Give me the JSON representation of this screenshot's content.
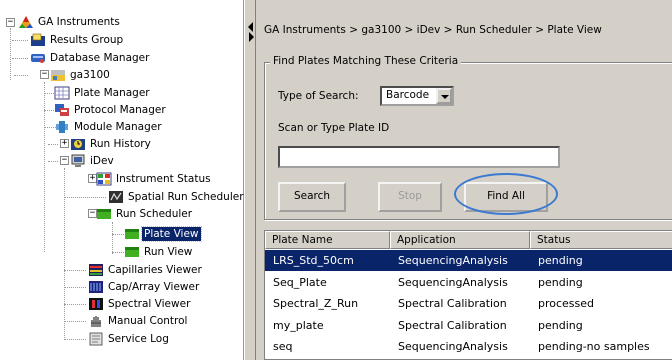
{
  "tree": {
    "root": "GA Instruments",
    "results_group": "Results Group",
    "database_manager": "Database Manager",
    "instrument": "ga3100",
    "plate_manager": "Plate Manager",
    "protocol_manager": "Protocol Manager",
    "module_manager": "Module Manager",
    "run_history": "Run History",
    "idev": "iDev",
    "instrument_status": "Instrument Status",
    "spatial_run_scheduler": "Spatial Run Scheduler",
    "run_scheduler": "Run Scheduler",
    "plate_view": "Plate View",
    "run_view": "Run View",
    "capillaries_viewer": "Capillaries Viewer",
    "cap_array_viewer": "Cap/Array Viewer",
    "spectral_viewer": "Spectral Viewer",
    "manual_control": "Manual Control",
    "service_log": "Service Log"
  },
  "main": {
    "breadcrumb": "GA Instruments > ga3100 > iDev > Run Scheduler > Plate View",
    "group_title": "Find Plates Matching These Criteria",
    "type_of_search_label": "Type of Search:",
    "type_of_search_value": "Barcode",
    "scan_label": "Scan or Type Plate ID",
    "plate_id_value": "",
    "search_button": "Search",
    "stop_button": "Stop",
    "find_all_button": "Find All"
  },
  "table": {
    "headers": [
      "Plate Name",
      "Application",
      "Status"
    ],
    "rows": [
      [
        "LRS_Std_50cm",
        "SequencingAnalysis",
        "pending"
      ],
      [
        "Seq_Plate",
        "SequencingAnalysis",
        "pending"
      ],
      [
        "Spectral_Z_Run",
        "Spectral Calibration",
        "processed"
      ],
      [
        "my_plate",
        "Spectral Calibration",
        "pending"
      ],
      [
        "seq",
        "SequencingAnalysis",
        "pending-no samples"
      ]
    ],
    "selected_row": 0
  },
  "colors": {
    "selection": "#0a246a",
    "panel": "#d4d0c8",
    "highlight_ring": "#3a7ad0"
  }
}
